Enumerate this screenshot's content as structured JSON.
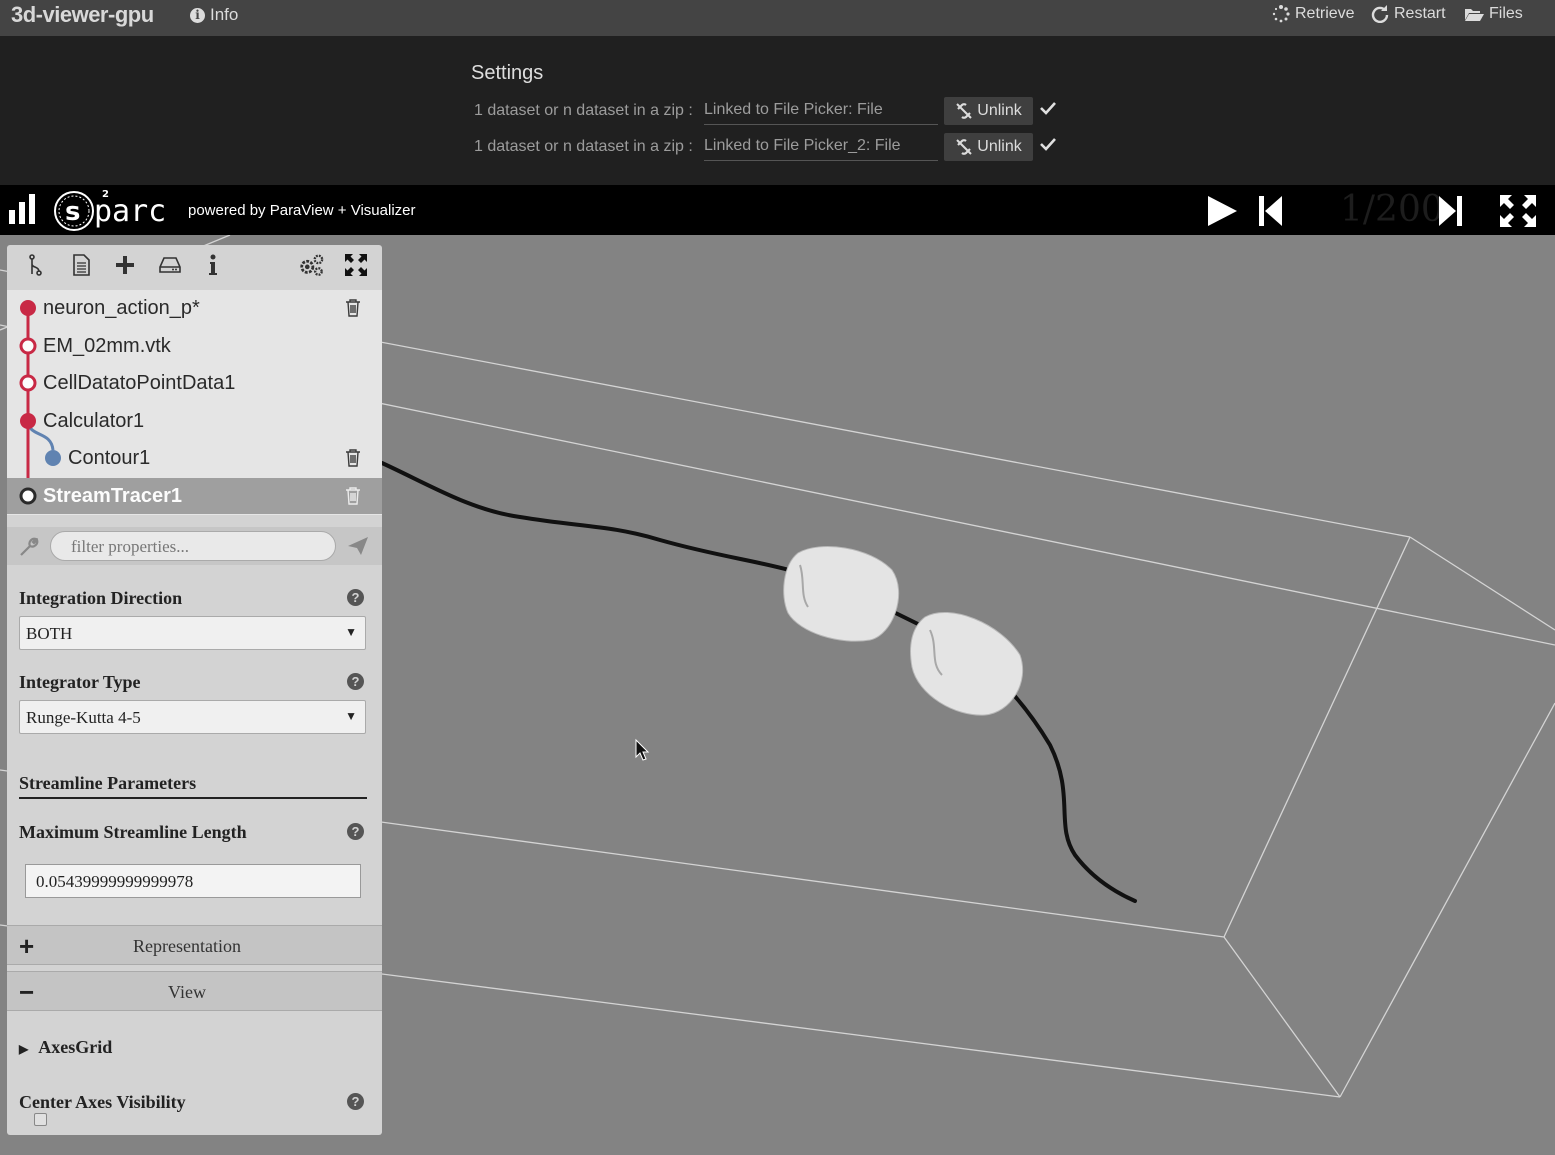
{
  "topbar": {
    "app_title": "3d-viewer-gpu",
    "info_label": "Info",
    "retrieve_label": "Retrieve",
    "restart_label": "Restart",
    "files_label": "Files"
  },
  "settings": {
    "title": "Settings",
    "rows": [
      {
        "label": "1 dataset or n dataset in a zip :",
        "value": "Linked to File Picker: File",
        "button": "Unlink"
      },
      {
        "label": "1 dataset or n dataset in a zip :",
        "value": "Linked to File Picker_2: File",
        "button": "Unlink"
      }
    ]
  },
  "viewer_bar": {
    "powered_by": "powered by ParaView + Visualizer",
    "frame_counter": "1/200"
  },
  "pipeline": {
    "items": [
      {
        "label": "neuron_action_p*",
        "color": "#c8203e"
      },
      {
        "label": "EM_02mm.vtk",
        "color": "#c8203e"
      },
      {
        "label": "CellDatatoPointData1",
        "color": "#c8203e"
      },
      {
        "label": "Calculator1",
        "color": "#c8203e"
      },
      {
        "label": "Contour1",
        "color": "#5a7fb0"
      },
      {
        "label": "StreamTracer1",
        "color": "#222222"
      }
    ]
  },
  "properties": {
    "filter_placeholder": "filter properties...",
    "integration_direction": {
      "label": "Integration Direction",
      "value": "BOTH"
    },
    "integrator_type": {
      "label": "Integrator Type",
      "value": "Runge-Kutta 4-5"
    },
    "streamline_section": "Streamline Parameters",
    "max_streamline_length": {
      "label": "Maximum Streamline Length",
      "value": "0.05439999999999978"
    },
    "representation_group": "Representation",
    "view_group": "View",
    "axes_grid": "AxesGrid",
    "center_axes_visibility": {
      "label": "Center Axes Visibility",
      "checked": false
    }
  },
  "colors": {
    "topbar_bg": "#444444",
    "viewport_bg": "#838383",
    "accent_red": "#c8203e",
    "accent_blue": "#5a7fb0"
  }
}
